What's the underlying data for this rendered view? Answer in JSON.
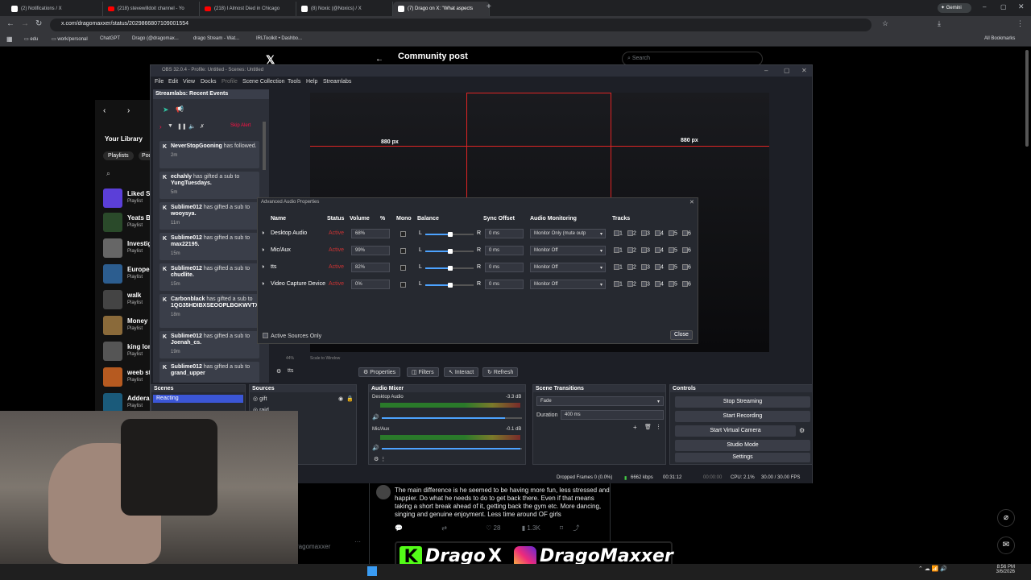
{
  "browser": {
    "tabs": [
      {
        "label": "(2) Notifications / X",
        "icon": "x-icon"
      },
      {
        "label": "(218) stevewilldoit channel - Yo",
        "icon": "youtube-icon"
      },
      {
        "label": "(218) I Almost Died in Chicago",
        "icon": "youtube-icon"
      },
      {
        "label": "(8) Noxic (@Noxics) / X",
        "icon": "x-icon"
      },
      {
        "label": "(7) Drago on X: \"What aspects",
        "icon": "x-icon"
      }
    ],
    "gemini": "Gemini",
    "url": "x.com/dragomaxxer/status/2029866807109001554",
    "bookmarks": [
      "edu",
      "work/personal",
      "ChatGPT",
      "Drago (@dragomax...",
      "drago Stream - Wat...",
      "IRLToolkit • Dashbo..."
    ],
    "all_bookmarks": "All Bookmarks"
  },
  "x": {
    "post_title": "Community post",
    "search_placeholder": "Search",
    "library_title": "Your Library",
    "filters": [
      "Playlists",
      "Pod"
    ],
    "library": [
      {
        "name": "Liked So",
        "sub": "Playlist"
      },
      {
        "name": "Yeats B",
        "sub": "Playlist"
      },
      {
        "name": "Investig",
        "sub": "Playlist"
      },
      {
        "name": "Europe",
        "sub": "Playlist"
      },
      {
        "name": "walk",
        "sub": "Playlist"
      },
      {
        "name": "Money l",
        "sub": "Playlist"
      },
      {
        "name": "king lon",
        "sub": "Playlist"
      },
      {
        "name": "weeb st",
        "sub": "Playlist"
      },
      {
        "name": "Addera",
        "sub": "Playlist"
      }
    ],
    "reply_text": "The main difference is he seemed to be having more fun, less stressed and happier. Do what he needs to do to get back there. Even if that means taking a short break ahead of it, getting back the gym etc. More dancing, singing and genuine enjoyment. Less time around OF girls",
    "likes": "28",
    "views": "1.3K",
    "handle": "ragomaxxer"
  },
  "obs": {
    "title": "OBS 32.0.4 - Profile: Untitled - Scenes: Untitled",
    "menu": [
      "File",
      "Edit",
      "View",
      "Docks",
      "Profile",
      "Scene Collection",
      "Tools",
      "Help",
      "Streamlabs"
    ],
    "streamlabs_title": "Streamlabs: Recent Events",
    "skip_alert": "Skip Alert",
    "events": [
      {
        "name": "NeverStopGooning",
        "action": "has followed.",
        "time": "2m"
      },
      {
        "name": "echahly",
        "action": "has gifted a sub to",
        "target": "YungTuesdays.",
        "time": "5m"
      },
      {
        "name": "Sublime012",
        "action": "has gifted a sub to",
        "target": "wooysya.",
        "time": "11m"
      },
      {
        "name": "Sublime012",
        "action": "has gifted a sub to",
        "target": "max22195.",
        "time": "15m"
      },
      {
        "name": "Sublime012",
        "action": "has gifted a sub to",
        "target": "chudlite.",
        "time": "15m"
      },
      {
        "name": "Carbonblack",
        "action": "has gifted a sub to",
        "target": "1QG35HDIBXSEOOPLBGKWVTX.",
        "time": "18m"
      },
      {
        "name": "Sublime012",
        "action": "has gifted a sub to",
        "target": "Joenah_cs.",
        "time": "19m"
      },
      {
        "name": "Sublime012",
        "action": "has gifted a sub to",
        "target": "grand_upper",
        "time": ""
      }
    ],
    "preview_label": "880 px",
    "advanced_audio": {
      "title": "Advanced Audio Properties",
      "headers": [
        "Name",
        "Status",
        "Volume",
        "%",
        "Mono",
        "Balance",
        "Sync Offset",
        "Audio Monitoring",
        "Tracks"
      ],
      "rows": [
        {
          "name": "Desktop Audio",
          "status": "Active",
          "volume": "68%",
          "vol_fraction": 0.68,
          "sync": "0 ms",
          "monitor": "Monitor Only (mute outp"
        },
        {
          "name": "Mic/Aux",
          "status": "Active",
          "volume": "99%",
          "vol_fraction": 0.99,
          "sync": "0 ms",
          "monitor": "Monitor Off"
        },
        {
          "name": "tts",
          "status": "Active",
          "volume": "82%",
          "vol_fraction": 0.82,
          "sync": "0 ms",
          "monitor": "Monitor Off"
        },
        {
          "name": "Video Capture Device",
          "status": "Active",
          "volume": "0%",
          "vol_fraction": 0.0,
          "sync": "0 ms",
          "monitor": "Monitor Off"
        }
      ],
      "balance_l": "L",
      "balance_r": "R",
      "tracks": [
        "1",
        "2",
        "3",
        "4",
        "5",
        "6"
      ],
      "active_only": "Active Sources Only",
      "close": "Close"
    },
    "scale_label": "Scale to Window",
    "zoom": "44%",
    "selected_source": "tts",
    "source_buttons": [
      "Properties",
      "Filters",
      "Interact",
      "Refresh"
    ],
    "scenes_title": "Scenes",
    "scenes": [
      "Reacting"
    ],
    "sources_title": "Sources",
    "sources": [
      "gift",
      "raid"
    ],
    "mixer_title": "Audio Mixer",
    "mixer": [
      {
        "name": "Desktop Audio",
        "db": "-3.3 dB"
      },
      {
        "name": "Mic/Aux",
        "db": "-0.1 dB"
      }
    ],
    "transitions_title": "Scene Transitions",
    "transition": "Fade",
    "duration_label": "Duration",
    "duration": "400 ms",
    "controls_title": "Controls",
    "controls": [
      "Stop Streaming",
      "Start Recording",
      "Start Virtual Camera",
      "Studio Mode",
      "Settings"
    ],
    "status": {
      "dropped": "Dropped Frames 0 (0.0%)",
      "bitrate": "6662 kbps",
      "stream_time": "00:31:12",
      "rec_time": "00:00:00",
      "cpu": "CPU: 2.1%",
      "fps": "30.00 / 30.00 FPS"
    }
  },
  "overlay": {
    "kick_name": "Drago",
    "ig_name": "DragoMaxxer",
    "k": "K",
    "x": "X"
  },
  "taskbar": {
    "time": "8:56 PM",
    "date": "3/6/2026"
  }
}
